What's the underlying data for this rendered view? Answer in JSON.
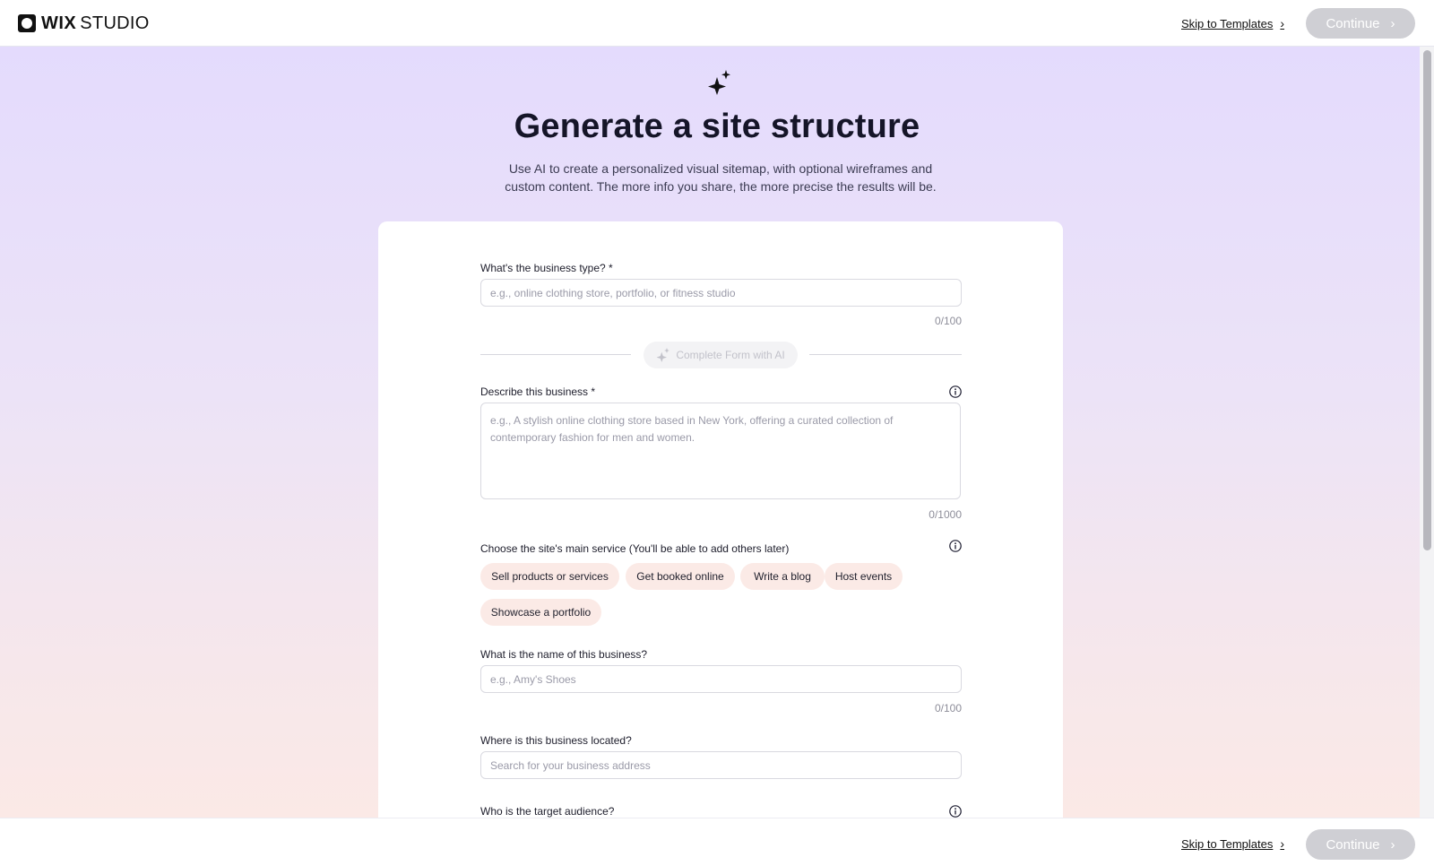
{
  "header": {
    "logo_wix": "WIX",
    "logo_studio": "STUDIO",
    "skip_label": "Skip to Templates",
    "continue_label": "Continue"
  },
  "hero": {
    "title": "Generate a site structure",
    "subtitle": "Use AI to create a personalized visual sitemap, with optional wireframes and custom content. The more info you share, the more precise the results will be."
  },
  "form": {
    "business_type": {
      "label": "What's the business type? *",
      "placeholder": "e.g., online clothing store, portfolio, or fitness studio",
      "counter": "0/100"
    },
    "ai_button_label": "Complete Form with AI",
    "description": {
      "label": "Describe this business *",
      "placeholder": "e.g., A stylish online clothing store based in New York, offering a curated collection of contemporary fashion for men and women.",
      "counter": "0/1000"
    },
    "main_service": {
      "label": "Choose the site's main service (You'll be able to add others later)",
      "options": [
        "Sell products or services",
        "Get booked online",
        "Write a blog",
        "Host events",
        "Showcase a portfolio"
      ]
    },
    "business_name": {
      "label": "What is the name of this business?",
      "placeholder": "e.g., Amy's Shoes",
      "counter": "0/100"
    },
    "location": {
      "label": "Where is this business located?",
      "placeholder": "Search for your business address"
    },
    "audience": {
      "label": "Who is the target audience?"
    }
  },
  "footer": {
    "skip_label": "Skip to Templates",
    "continue_label": "Continue"
  },
  "icons": {
    "sparkle": "sparkle-icon",
    "info": "info-icon",
    "chevron": "chevron-right-icon"
  },
  "colors": {
    "chip_bg": "#fbeae6",
    "continue_disabled": "#cfcfd4",
    "gradient_top": "#e4dbfd",
    "gradient_bottom": "#fbe9e6"
  }
}
